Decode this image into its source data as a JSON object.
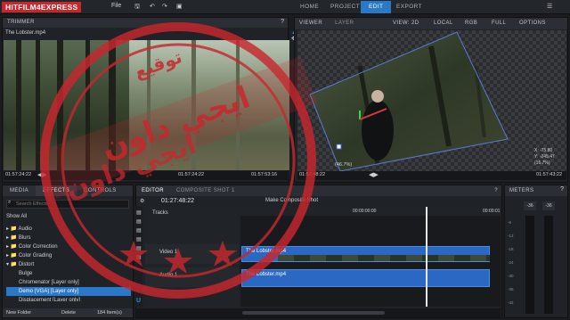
{
  "app": {
    "logo_text": "HITFILM4EXPRESS",
    "menu_file": "File",
    "tabs": [
      "HOME",
      "PROJECT",
      "EDIT",
      "EXPORT"
    ],
    "active_tab": "EDIT",
    "accent": "#2a78c8",
    "brand_red": "#c9252b"
  },
  "trimmer": {
    "title": "TRIMMER",
    "clip_name": "The Lobster.mp4",
    "time_left": "01:57:24:22",
    "time_mid": "01:57:24:22",
    "time_right": "01:57:53:16"
  },
  "viewer": {
    "title": "VIEWER",
    "layer_tab": "LAYER",
    "view_label": "VIEW: 2D",
    "local_label": "LOCAL",
    "rgb_label": "RGB",
    "full_label": "FULL",
    "options_label": "OPTIONS",
    "readout_x": "X: -75.80",
    "readout_y": "Y: -245.47",
    "readout_z": "(16.7%)",
    "zoom_left": "(46.7%)",
    "time_left": "01:57:48:22",
    "time_right": "01:57:43:22"
  },
  "effects_panel": {
    "tabs": [
      "MEDIA",
      "EFFECTS",
      "CONTROLS"
    ],
    "search_placeholder": "Search Effects",
    "show_all": "Show All",
    "categories": [
      "Audio",
      "Blurs",
      "Color Correction",
      "Color Grading",
      "Distort"
    ],
    "items": [
      "Bulge",
      "Chromenator [Layer only]",
      "Demo (VGA) [Layer only]",
      "Displacement [Layer only]"
    ],
    "selected_item": "Demo (VGA) [Layer only]",
    "new_folder": "New Folder",
    "delete": "Delete",
    "count": "184 Item(s)"
  },
  "editor": {
    "title": "EDITOR",
    "composite_tab": "COMPOSITE SHOT 1",
    "timecode": "01:27:48:22",
    "tracks_label": "Tracks",
    "make_composite": "Make Composite Shot",
    "ruler_mid": "00:00:00:00",
    "ruler_right": "00:00:01",
    "video_track": "Video 1",
    "audio_track": "Audio 1",
    "clip_video": "The Lobster.mp4",
    "clip_audio": "The Lobster.mp4"
  },
  "meters": {
    "title": "METERS",
    "left_db": "-36",
    "right_db": "-36",
    "scale": [
      "-6",
      "-12",
      "-18",
      "-24",
      "-30",
      "-36",
      "-42"
    ]
  },
  "stamp": {
    "top_text": "توقيع",
    "main_text": "ايجي داون",
    "bottom_text": "ايجي داون"
  }
}
